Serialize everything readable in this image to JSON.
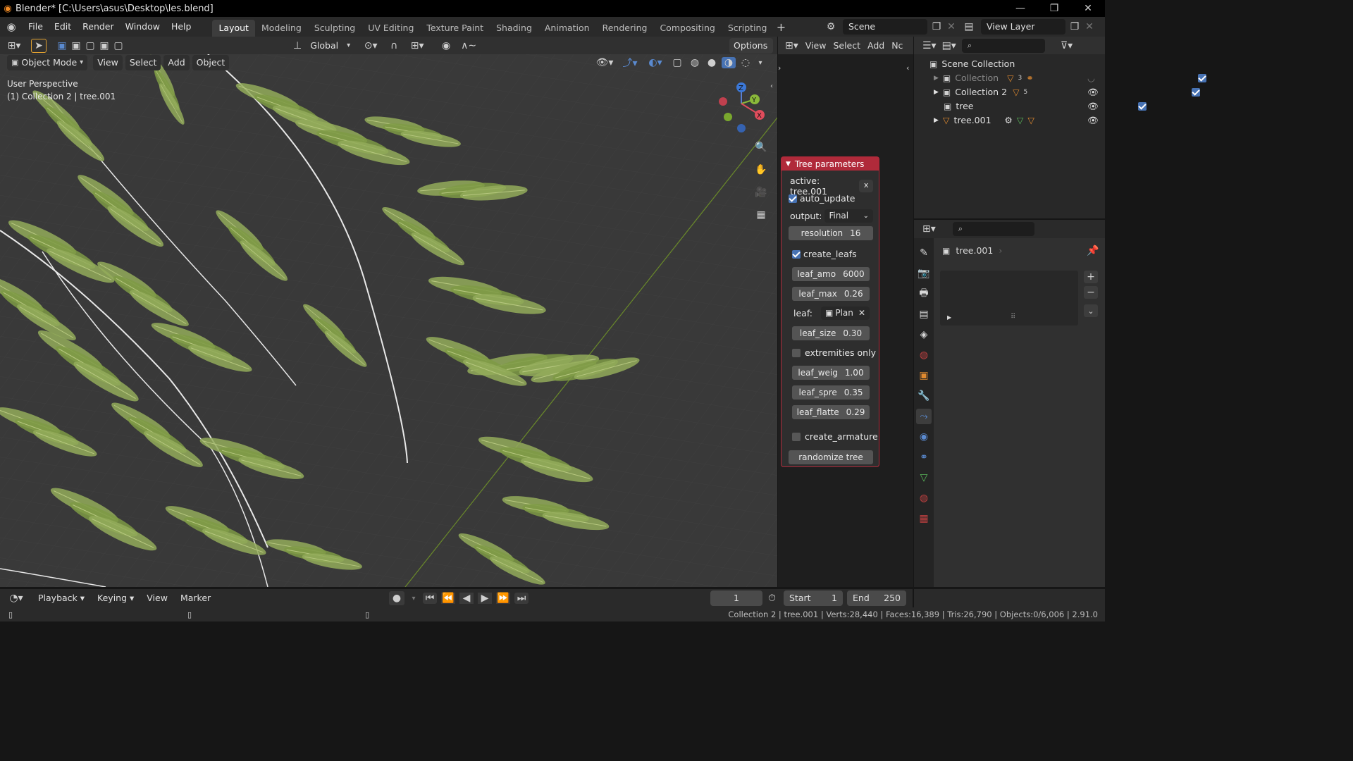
{
  "titlebar": {
    "title": "Blender* [C:\\Users\\asus\\Desktop\\les.blend]"
  },
  "menus": [
    "File",
    "Edit",
    "Render",
    "Window",
    "Help"
  ],
  "workspaces": [
    "Layout",
    "Modeling",
    "Sculpting",
    "UV Editing",
    "Texture Paint",
    "Shading",
    "Animation",
    "Rendering",
    "Compositing",
    "Scripting"
  ],
  "scene": {
    "name": "Scene",
    "view_layer": "View Layer"
  },
  "toolbar": {
    "transform_orientation": "Global",
    "options": "Options"
  },
  "viewport_header": {
    "mode": "Object Mode",
    "view": "View",
    "select": "Select",
    "add": "Add",
    "object": "Object"
  },
  "viewport": {
    "perspective": "User Perspective",
    "active_info": "(1) Collection 2 | tree.001"
  },
  "gizmo": {
    "x": "X",
    "y": "Y",
    "z": "Z"
  },
  "mid_editor": {
    "view": "View",
    "select": "Select",
    "add": "Add",
    "trunc": "Nc"
  },
  "tree_panel": {
    "title": "Tree parameters",
    "active": "active: tree.001",
    "clear": "x",
    "auto_update": "auto_update",
    "output_label": "output:",
    "output_value": "Final",
    "resolution": {
      "label": "resolution",
      "value": "16"
    },
    "create_leafs": "create_leafs",
    "leaf_amo": {
      "label": "leaf_amo",
      "value": "6000"
    },
    "leaf_max": {
      "label": "leaf_max",
      "value": "0.26"
    },
    "leaf_label": "leaf:",
    "leaf_value": "Plan",
    "leaf_size": {
      "label": "leaf_size",
      "value": "0.30"
    },
    "extremities_only": "extremities only",
    "leaf_weig": {
      "label": "leaf_weig",
      "value": "1.00"
    },
    "leaf_spre": {
      "label": "leaf_spre",
      "value": "0.35"
    },
    "leaf_flatte": {
      "label": "leaf_flatte",
      "value": "0.29"
    },
    "create_armature": "create_armature",
    "randomize": "randomize tree"
  },
  "outliner": {
    "scene_collection": "Scene Collection",
    "items": [
      {
        "name": "Collection",
        "badge": "3"
      },
      {
        "name": "Collection 2",
        "badge": "5"
      },
      {
        "name": "tree",
        "badge": ""
      },
      {
        "name": "tree.001",
        "badge": ""
      }
    ]
  },
  "properties": {
    "object_name": "tree.001"
  },
  "timeline": {
    "playback": "Playback",
    "keying": "Keying",
    "view": "View",
    "marker": "Marker",
    "frame": "1",
    "start_label": "Start",
    "start": "1",
    "end_label": "End",
    "end": "250"
  },
  "status": {
    "text": "Collection 2 | tree.001 | Verts:28,440 | Faces:16,389 | Tris:26,790 | Objects:0/6,006 | 2.91.0"
  },
  "colors": {
    "accent": "#4772b3",
    "panel_header": "#b02a3a",
    "active_tab": "#3d3d3d",
    "leaf_green": "#8aa04e"
  }
}
